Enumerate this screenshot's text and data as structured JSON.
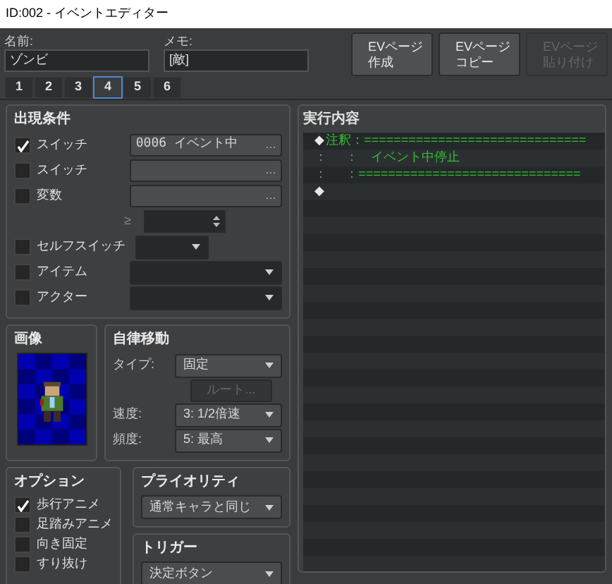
{
  "window": {
    "title": "ID:002 - イベントエディター"
  },
  "name": {
    "label": "名前:",
    "value": "ゾンビ"
  },
  "memo": {
    "label": "メモ:",
    "value": "[敵]"
  },
  "page_buttons": [
    {
      "lines": [
        "EVページ",
        "作成"
      ],
      "disabled": false
    },
    {
      "lines": [
        "EVページ",
        "コピー"
      ],
      "disabled": false
    },
    {
      "lines": [
        "EVページ",
        "貼り付け"
      ],
      "disabled": true
    }
  ],
  "page_tabs": [
    {
      "label": "1",
      "selected": false
    },
    {
      "label": "2",
      "selected": false
    },
    {
      "label": "3",
      "selected": false
    },
    {
      "label": "4",
      "selected": true
    },
    {
      "label": "5",
      "selected": false
    },
    {
      "label": "6",
      "selected": false
    }
  ],
  "conditions": {
    "title": "出現条件",
    "rows": [
      {
        "kind": "picker",
        "label": "スイッチ",
        "checked": true,
        "value": "0006 イベント中",
        "button": "…"
      },
      {
        "kind": "picker",
        "label": "スイッチ",
        "checked": false,
        "button": "…"
      },
      {
        "kind": "picker",
        "label": "変数",
        "checked": false,
        "button": "…"
      },
      {
        "kind": "number",
        "symbol": "≥"
      },
      {
        "kind": "small-select",
        "label": "セルフスイッチ",
        "checked": false
      },
      {
        "kind": "select",
        "label": "アイテム",
        "checked": false
      },
      {
        "kind": "select",
        "label": "アクター",
        "checked": false
      }
    ]
  },
  "image": {
    "title": "画像"
  },
  "movement": {
    "title": "自律移動",
    "type": {
      "label": "タイプ:",
      "value": "固定"
    },
    "route": {
      "label": "ルート...",
      "disabled": true
    },
    "speed": {
      "label": "速度:",
      "value": "3: 1/2倍速"
    },
    "frequency": {
      "label": "頻度:",
      "value": "5: 最高"
    }
  },
  "options": {
    "title": "オプション",
    "items": [
      {
        "label": "歩行アニメ",
        "checked": true
      },
      {
        "label": "足踏みアニメ",
        "checked": false
      },
      {
        "label": "向き固定",
        "checked": false
      },
      {
        "label": "すり抜け",
        "checked": false
      }
    ]
  },
  "priority": {
    "title": "プライオリティ",
    "value": "通常キャラと同じ"
  },
  "trigger": {
    "title": "トリガー",
    "value": "決定ボタン"
  },
  "contents": {
    "title": "実行内容",
    "lines": [
      {
        "kind": "comment",
        "marker": "◆",
        "label": "注釈",
        "text": "：=============================="
      },
      {
        "kind": "continue",
        "marker": "：",
        "text": "：　イベント中停止"
      },
      {
        "kind": "continue",
        "marker": "：",
        "text": "：=============================="
      },
      {
        "kind": "end",
        "marker": "◆"
      }
    ]
  }
}
